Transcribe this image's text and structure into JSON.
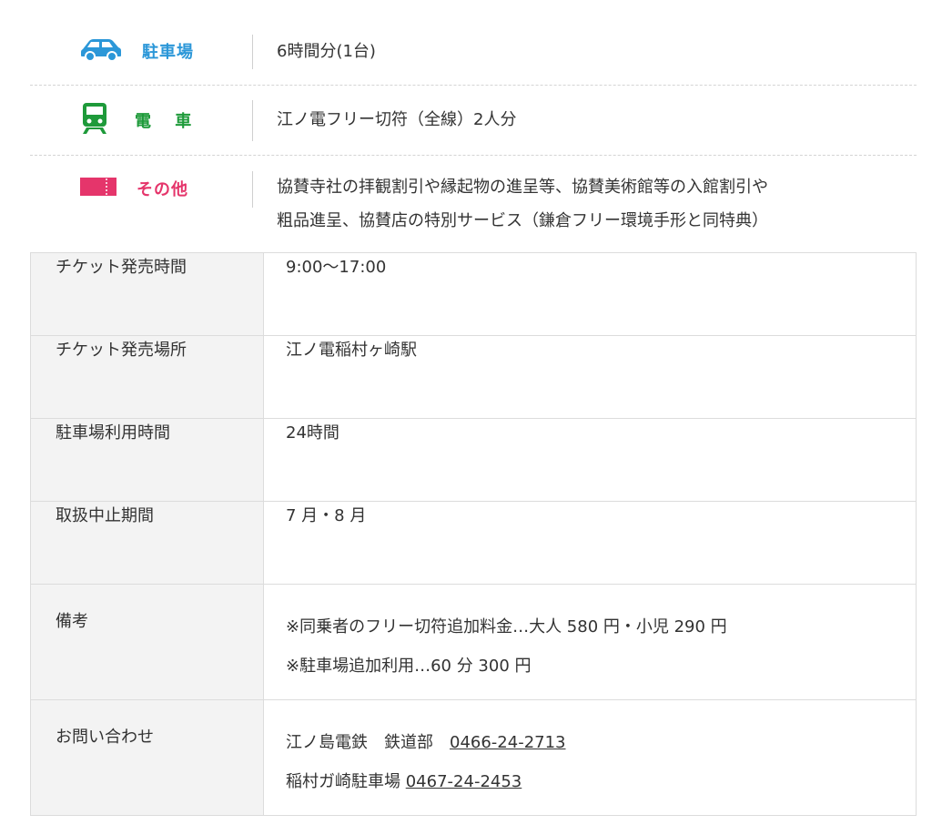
{
  "features": [
    {
      "icon": "car-icon",
      "label": "駐車場",
      "color": "#2b97d8",
      "text": "6時間分(1台)"
    },
    {
      "icon": "train-icon",
      "label": "電 車",
      "color": "#1e9a3a",
      "text": "江ノ電フリー切符（全線）2人分"
    },
    {
      "icon": "ticket-icon",
      "label": "その他",
      "color": "#e5356b",
      "text_line1": "協賛寺社の拝観割引や縁起物の進呈等、協賛美術館等の入館割引や",
      "text_line2": "粗品進呈、協賛店の特別サービス（鎌倉フリー環境手形と同特典）"
    }
  ],
  "table": {
    "sale_hours": {
      "label": "チケット発売時間",
      "value": "9:00〜17:00"
    },
    "sale_place": {
      "label": "チケット発売場所",
      "value": "江ノ電稲村ヶ崎駅"
    },
    "parking_hours": {
      "label": "駐車場利用時間",
      "value": "24時間"
    },
    "suspension": {
      "label": "取扱中止期間",
      "value": "7 月・8 月"
    },
    "notes": {
      "label": "備考",
      "line1": "※同乗者のフリー切符追加料金…大人 580 円・小児 290 円",
      "line2": "※駐車場追加利用…60 分 300 円"
    },
    "contact": {
      "label": "お問い合わせ",
      "line1_text": "江ノ島電鉄　鉄道部　",
      "line1_phone": "0466-24-2713",
      "line2_text": "稲村ガ崎駐車場 ",
      "line2_phone": "0467-24-2453"
    }
  }
}
